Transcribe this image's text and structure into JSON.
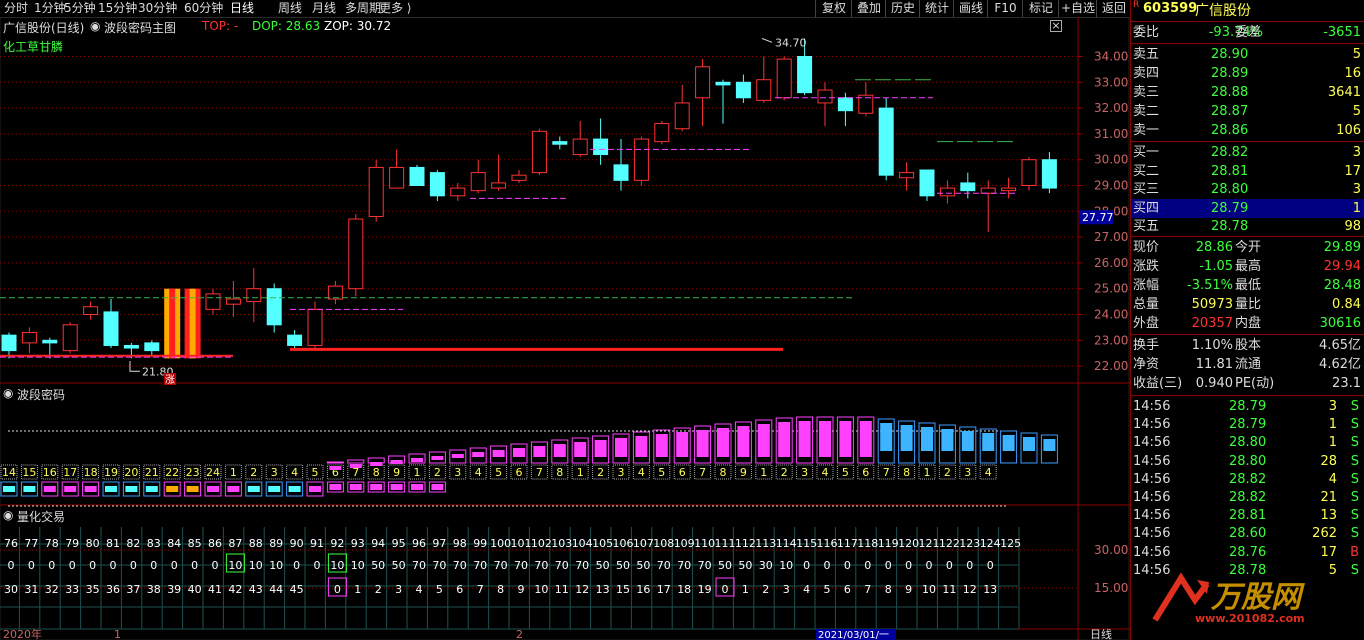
{
  "toolbar": {
    "periods": [
      "分时",
      "1分钟",
      "5分钟",
      "15分钟",
      "30分钟",
      "60分钟",
      "日线",
      "周线",
      "月线",
      "多周期",
      "更多"
    ],
    "active_period": "日线",
    "right_buttons": [
      "复权",
      "叠加",
      "历史",
      "统计",
      "画线",
      "F10",
      "标记",
      "+自选",
      "返回"
    ]
  },
  "chart_header": {
    "stock": "广信股份(日线)",
    "indicator": "波段密码主图",
    "top": "TOP: -",
    "dop": "DOP: 28.63",
    "zop": "ZOP: 30.72",
    "sector": "化工草甘膦"
  },
  "price_axis": {
    "ticks": [
      "34.00",
      "33.00",
      "32.00",
      "31.00",
      "30.00",
      "29.00",
      "28.00",
      "27.00",
      "26.00",
      "25.00",
      "24.00",
      "23.00",
      "22.00"
    ],
    "current_label": "27.77",
    "high_mark": "34.70",
    "low_mark": "21.80",
    "low_badge": "涨"
  },
  "subpanel1": {
    "title": "波段密码",
    "counters": [
      "14",
      "15",
      "16",
      "17",
      "18",
      "19",
      "20",
      "21",
      "22",
      "23",
      "24",
      "1",
      "2",
      "3",
      "4",
      "5",
      "6",
      "7",
      "8",
      "9",
      "1",
      "2",
      "3",
      "4",
      "5",
      "6",
      "7",
      "8",
      "1",
      "2",
      "3",
      "4",
      "5",
      "6",
      "7",
      "8",
      "9",
      "1",
      "2",
      "3",
      "4",
      "5",
      "6",
      "7",
      "8",
      "1",
      "2",
      "3",
      "4"
    ]
  },
  "subpanel2": {
    "title": "量化交易",
    "axis": [
      "30.00",
      "15.00"
    ],
    "row1": [
      "76",
      "77",
      "78",
      "79",
      "80",
      "81",
      "82",
      "83",
      "84",
      "85",
      "86",
      "87",
      "88",
      "89",
      "90",
      "91",
      "92",
      "93",
      "94",
      "95",
      "96",
      "97",
      "98",
      "99",
      "100",
      "101",
      "102",
      "103",
      "104",
      "105",
      "106",
      "107",
      "108",
      "109",
      "110",
      "111",
      "112",
      "113",
      "114",
      "115",
      "116",
      "117",
      "118",
      "119",
      "120",
      "121",
      "122",
      "123",
      "124",
      "125"
    ],
    "row2": [
      "0",
      "0",
      "0",
      "0",
      "0",
      "0",
      "0",
      "0",
      "0",
      "0",
      "0",
      "10",
      "10",
      "10",
      "0",
      "0",
      "10",
      "10",
      "50",
      "50",
      "70",
      "70",
      "70",
      "70",
      "70",
      "70",
      "70",
      "70",
      "70",
      "50",
      "50",
      "50",
      "70",
      "70",
      "70",
      "50",
      "50",
      "30",
      "10",
      "0",
      "0",
      "0",
      "0",
      "0",
      "0",
      "0",
      "0",
      "0",
      "0"
    ],
    "row3": [
      "30",
      "31",
      "32",
      "33",
      "35",
      "36",
      "37",
      "38",
      "39",
      "40",
      "41",
      "42",
      "43",
      "44",
      "45",
      "0",
      "1",
      "2",
      "3",
      "4",
      "5",
      "6",
      "7",
      "8",
      "9",
      "10",
      "11",
      "12",
      "13",
      "15",
      "16",
      "17",
      "18",
      "19",
      "0",
      "1",
      "2",
      "3",
      "4",
      "5",
      "6",
      "7",
      "8",
      "9",
      "10",
      "11",
      "12",
      "13"
    ]
  },
  "bottom_axis": {
    "year": "2020年",
    "m1": "1",
    "m2": "2",
    "date": "2021/03/01/一",
    "period": "日线"
  },
  "quote": {
    "code": "603599",
    "name": "广信股份",
    "ratio_label": "委比",
    "ratio": "-93.74%",
    "diff_label": "委差",
    "diff": "-3651",
    "asks": [
      {
        "label": "卖五",
        "price": "28.90",
        "vol": "5"
      },
      {
        "label": "卖四",
        "price": "28.89",
        "vol": "16"
      },
      {
        "label": "卖三",
        "price": "28.88",
        "vol": "3641"
      },
      {
        "label": "卖二",
        "price": "28.87",
        "vol": "5"
      },
      {
        "label": "卖一",
        "price": "28.86",
        "vol": "106"
      }
    ],
    "bids": [
      {
        "label": "买一",
        "price": "28.82",
        "vol": "3"
      },
      {
        "label": "买二",
        "price": "28.81",
        "vol": "17"
      },
      {
        "label": "买三",
        "price": "28.80",
        "vol": "3"
      },
      {
        "label": "买四",
        "price": "28.79",
        "vol": "1"
      },
      {
        "label": "买五",
        "price": "28.78",
        "vol": "98"
      }
    ],
    "stats": [
      {
        "l1": "现价",
        "v1": "28.86",
        "l2": "今开",
        "v2": "29.89"
      },
      {
        "l1": "涨跌",
        "v1": "-1.05",
        "l2": "最高",
        "v2": "29.94"
      },
      {
        "l1": "涨幅",
        "v1": "-3.51%",
        "l2": "最低",
        "v2": "28.48"
      },
      {
        "l1": "总量",
        "v1": "50973",
        "l2": "量比",
        "v2": "0.84"
      },
      {
        "l1": "外盘",
        "v1": "20357",
        "l2": "内盘",
        "v2": "30616"
      }
    ],
    "stats2": [
      {
        "l1": "换手",
        "v1": "1.10%",
        "l2": "股本",
        "v2": "4.65亿"
      },
      {
        "l1": "净资",
        "v1": "11.81",
        "l2": "流通",
        "v2": "4.62亿"
      },
      {
        "l1": "收益(三)",
        "v1": "0.940",
        "l2": "PE(动)",
        "v2": "23.1"
      }
    ],
    "ticks": [
      {
        "t": "14:56",
        "p": "28.79",
        "v": "3",
        "s": "S"
      },
      {
        "t": "14:56",
        "p": "28.79",
        "v": "1",
        "s": "S"
      },
      {
        "t": "14:56",
        "p": "28.80",
        "v": "1",
        "s": "S"
      },
      {
        "t": "14:56",
        "p": "28.80",
        "v": "28",
        "s": "S"
      },
      {
        "t": "14:56",
        "p": "28.82",
        "v": "4",
        "s": "S"
      },
      {
        "t": "14:56",
        "p": "28.82",
        "v": "21",
        "s": "S"
      },
      {
        "t": "14:56",
        "p": "28.81",
        "v": "13",
        "s": "S"
      },
      {
        "t": "14:56",
        "p": "28.60",
        "v": "262",
        "s": "S"
      },
      {
        "t": "14:56",
        "p": "28.76",
        "v": "17",
        "s": "B"
      },
      {
        "t": "14:56",
        "p": "28.78",
        "v": "5",
        "s": "S"
      }
    ],
    "watermark": "万股网",
    "watermark_sub": "www.201082.com"
  },
  "colors": {
    "up": "#ff3232",
    "down": "#54ffff",
    "grid": "#8b0000",
    "label_orange": "#ff3232",
    "counter_yellow": "#ffff54",
    "magenta": "#ff40ff"
  }
}
